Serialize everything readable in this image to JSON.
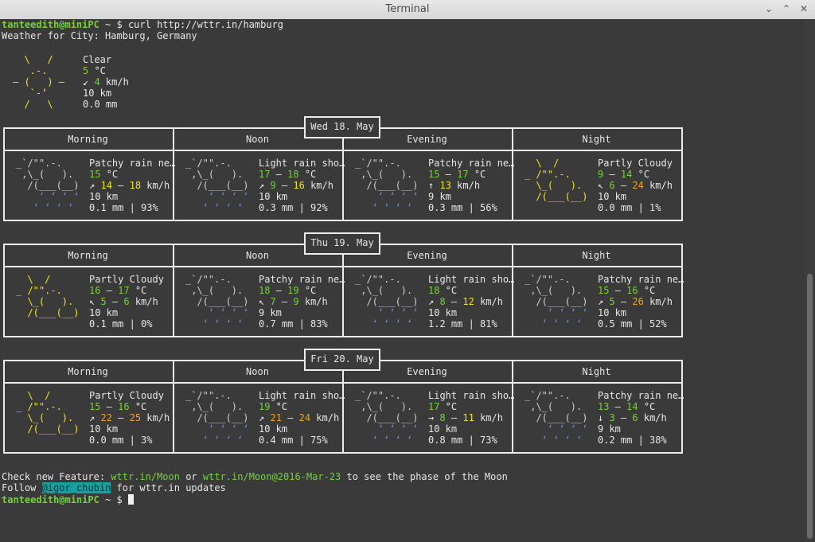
{
  "window": {
    "title": "Terminal",
    "minimize_glyph": "⌄",
    "maximize_glyph": "⌃",
    "close_glyph": "✕"
  },
  "prompt": {
    "user_host": "tanteedith@miniPC",
    "path": " ~ $ ",
    "command": "curl http://wttr.in/hamburg"
  },
  "header": {
    "location_line": "Weather for City: Hamburg, Germany"
  },
  "current": {
    "art": [
      "  \\   /    ",
      "   .-.     ",
      "― (   ) ―  ",
      "   `-’     ",
      "  /   \\    "
    ],
    "condition": "Clear",
    "temp": "5",
    "temp_unit": " °C",
    "wind_arrow": "↙",
    "wind": "4",
    "wind_unit": " km/h",
    "visibility": "10 km",
    "precip": "0.0 mm"
  },
  "days": [
    {
      "date": "Wed 18. May",
      "periods": [
        {
          "label": "Morning",
          "art": [
            "_`/\"\".-.",
            " ,\\_(   ).",
            "  /(___(__)",
            "    ‘ ‘ ‘ ‘",
            "   ‘ ‘ ‘ ‘"
          ],
          "art_color": "rain",
          "cond": "Patchy rain ne…",
          "t1": "15",
          "t2": "",
          "wa": "↗",
          "w1": "14",
          "w2": "18",
          "vis": "10 km",
          "precip": "0.1 mm | 93%"
        },
        {
          "label": "Noon",
          "art": [
            "_`/\"\".-.",
            " ,\\_(   ).",
            "  /(___(__)",
            "    ‘ ‘ ‘ ‘",
            "   ‘ ‘ ‘ ‘"
          ],
          "art_color": "rain",
          "cond": "Light rain sho…",
          "t1": "17",
          "t2": "18",
          "wa": "↗",
          "w1": "9",
          "w2": "16",
          "vis": "10 km",
          "precip": "0.3 mm | 92%"
        },
        {
          "label": "Evening",
          "art": [
            "_`/\"\".-.",
            " ,\\_(   ).",
            "  /(___(__)",
            "    ‘ ‘ ‘ ‘",
            "   ‘ ‘ ‘ ‘"
          ],
          "art_color": "rain",
          "cond": "Patchy rain ne…",
          "t1": "15",
          "t2": "17",
          "wa": "↑",
          "w1": "13",
          "w2": "",
          "vis": "9 km",
          "precip": "0.3 mm | 56%"
        },
        {
          "label": "Night",
          "art": [
            "  \\  /",
            "_ /\"\".-.",
            "  \\_(   ).",
            "  /(___(__)",
            ""
          ],
          "art_color": "cloud",
          "cond": "Partly Cloudy",
          "t1": "9",
          "t2": "14",
          "wa": "↖",
          "w1": "6",
          "w2": "24",
          "vis": "10 km",
          "precip": "0.0 mm | 1%"
        }
      ]
    },
    {
      "date": "Thu 19. May",
      "periods": [
        {
          "label": "Morning",
          "art": [
            "  \\  /",
            "_ /\"\".-.",
            "  \\_(   ).",
            "  /(___(__)",
            ""
          ],
          "art_color": "cloud",
          "cond": "Partly Cloudy",
          "t1": "16",
          "t2": "17",
          "wa": "↖",
          "w1": "5",
          "w2": "6",
          "vis": "10 km",
          "precip": "0.1 mm | 0%"
        },
        {
          "label": "Noon",
          "art": [
            "_`/\"\".-.",
            " ,\\_(   ).",
            "  /(___(__)",
            "    ‘ ‘ ‘ ‘",
            "   ‘ ‘ ‘ ‘"
          ],
          "art_color": "rain",
          "cond": "Patchy rain ne…",
          "t1": "18",
          "t2": "19",
          "wa": "↖",
          "w1": "7",
          "w2": "9",
          "vis": "9 km",
          "precip": "0.7 mm | 83%"
        },
        {
          "label": "Evening",
          "art": [
            "_`/\"\".-.",
            " ,\\_(   ).",
            "  /(___(__)",
            "    ‘ ‘ ‘ ‘",
            "   ‘ ‘ ‘ ‘"
          ],
          "art_color": "rain",
          "cond": "Light rain sho…",
          "t1": "18",
          "t2": "",
          "wa": "↗",
          "w1": "8",
          "w2": "12",
          "vis": "10 km",
          "precip": "1.2 mm | 81%"
        },
        {
          "label": "Night",
          "art": [
            "_`/\"\".-.",
            " ,\\_(   ).",
            "  /(___(__)",
            "    ‘ ‘ ‘ ‘",
            "   ‘ ‘ ‘ ‘"
          ],
          "art_color": "rain",
          "cond": "Patchy rain ne…",
          "t1": "15",
          "t2": "16",
          "wa": "↗",
          "w1": "5",
          "w2": "26",
          "vis": "10 km",
          "precip": "0.5 mm | 52%"
        }
      ]
    },
    {
      "date": "Fri 20. May",
      "periods": [
        {
          "label": "Morning",
          "art": [
            "  \\  /",
            "_ /\"\".-.",
            "  \\_(   ).",
            "  /(___(__)",
            ""
          ],
          "art_color": "cloud",
          "cond": "Partly Cloudy",
          "t1": "15",
          "t2": "16",
          "wa": "↗",
          "w1": "22",
          "w2": "25",
          "vis": "10 km",
          "precip": "0.0 mm | 3%"
        },
        {
          "label": "Noon",
          "art": [
            "_`/\"\".-.",
            " ,\\_(   ).",
            "  /(___(__)",
            "    ‘ ‘ ‘ ‘",
            "   ‘ ‘ ‘ ‘"
          ],
          "art_color": "rain",
          "cond": "Light rain sho…",
          "t1": "19",
          "t2": "",
          "wa": "↗",
          "w1": "21",
          "w2": "24",
          "vis": "10 km",
          "precip": "0.4 mm | 75%"
        },
        {
          "label": "Evening",
          "art": [
            "_`/\"\".-.",
            " ,\\_(   ).",
            "  /(___(__)",
            "    ‘ ‘ ‘ ‘",
            "   ‘ ‘ ‘ ‘"
          ],
          "art_color": "rain",
          "cond": "Light rain sho…",
          "t1": "17",
          "t2": "",
          "wa": "→",
          "w1": "8",
          "w2": "11",
          "vis": "10 km",
          "precip": "0.8 mm | 73%"
        },
        {
          "label": "Night",
          "art": [
            "_`/\"\".-.",
            " ,\\_(   ).",
            "  /(___(__)",
            "    ‘ ‘ ‘ ‘",
            "   ‘ ‘ ‘ ‘"
          ],
          "art_color": "rain",
          "cond": "Patchy rain ne…",
          "t1": "13",
          "t2": "14",
          "wa": "↓",
          "w1": "3",
          "w2": "6",
          "vis": "9 km",
          "precip": "0.2 mm | 38%"
        }
      ]
    }
  ],
  "footer": {
    "l1a": "Check new Feature: ",
    "moon_link": "wttr.in/Moon",
    "l1b": " or ",
    "moon_date_link": "wttr.in/Moon@2016-Mar-23",
    "l1c": " to see the phase of the Moon",
    "l2a": "Follow ",
    "handle": "@igor_chubin",
    "l2b": " for wttr.in updates"
  },
  "final_prompt": {
    "user_host": "tanteedith@miniPC",
    "path": " ~ $ "
  },
  "colors": {
    "green": "#74d13a",
    "yellow": "#f2e21a",
    "orange": "#f0a020",
    "rain_blue": "#6b8fe0",
    "link_bg": "#18a0a0"
  }
}
